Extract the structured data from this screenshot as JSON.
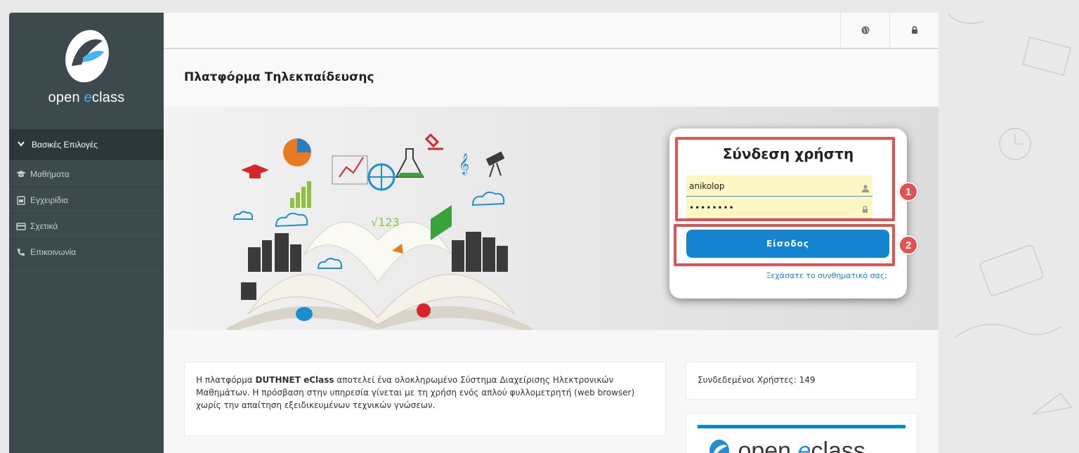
{
  "sidebar": {
    "logo_text_pre": "open ",
    "logo_text_e": "e",
    "logo_text_post": "class",
    "section_label": "Βασικές Επιλογές",
    "items": [
      {
        "label": "Μαθήματα",
        "icon": "graduation-cap-icon"
      },
      {
        "label": "Εγχειρίδια",
        "icon": "manual-icon"
      },
      {
        "label": "Σχετικά",
        "icon": "card-icon"
      },
      {
        "label": "Επικοινωνία",
        "icon": "phone-icon"
      }
    ]
  },
  "topbar": {
    "icons": [
      "globe-icon",
      "lock-icon"
    ]
  },
  "page": {
    "title": "Πλατφόρμα Τηλεκπαίδευσης"
  },
  "login": {
    "title": "Σύνδεση χρήστη",
    "username_value": "anikolop",
    "password_value": "••••••••",
    "submit_label": "Είσοδος",
    "forgot_label": "Ξεχάσατε το συνθηματικό σας;",
    "badges": [
      "1",
      "2"
    ],
    "highlight_color": "#e05352"
  },
  "info": {
    "pre": "Η πλατφόρμα ",
    "bold": "DUTHNET eClass",
    "post": " αποτελεί ένα ολοκληρωμένο Σύστημα Διαχείρισης Ηλεκτρονικών Μαθημάτων. Η πρόσβαση στην υπηρεσία γίνεται με τη χρήση ενός απλού φυλλομετρητή (web browser) χωρίς την απαίτηση εξειδικευμένων τεχνικών γνώσεων."
  },
  "online_users": "Συνδεδεμένοι Χρήστες: 149",
  "footer_logo": {
    "pre": "open ",
    "e": "e",
    "post": "class"
  },
  "colors": {
    "accent": "#1385d0",
    "sidebar_bg": "#3c4a4d",
    "highlight": "#e05352"
  }
}
